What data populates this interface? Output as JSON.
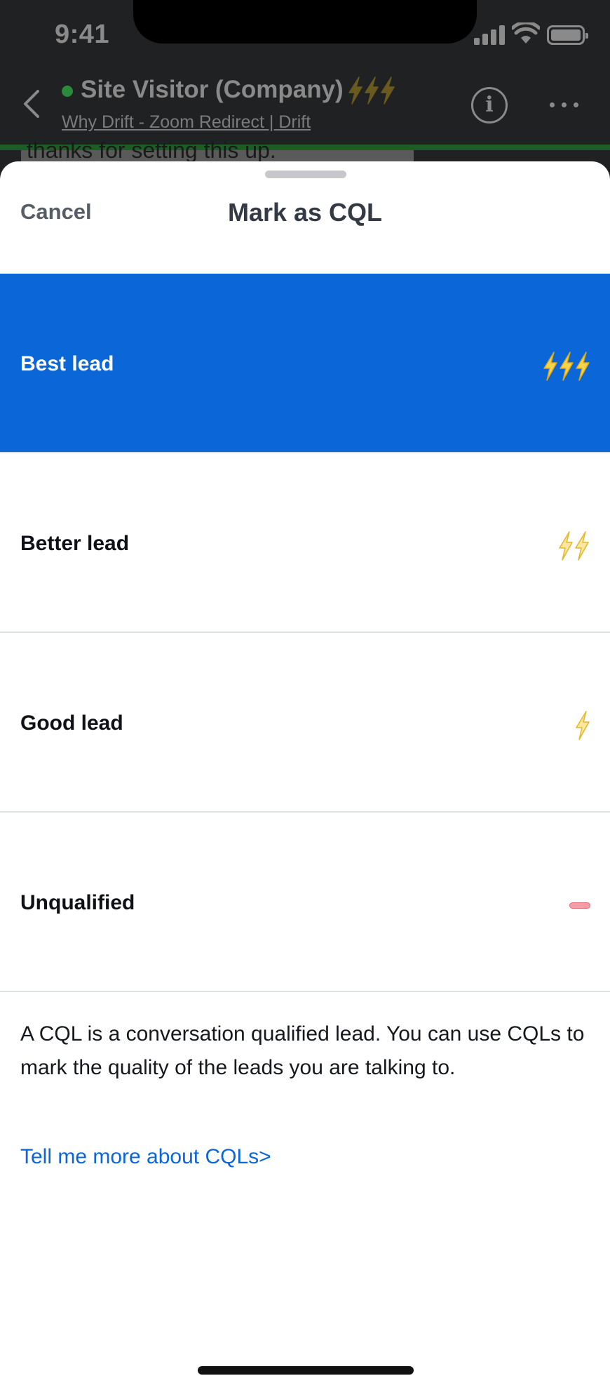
{
  "status": {
    "time": "9:41"
  },
  "background_chat": {
    "visitor_name": "Site Visitor (Company)",
    "page_link": "Why Drift - Zoom Redirect | Drift",
    "peek_message": "thanks for setting this up."
  },
  "sheet": {
    "cancel_label": "Cancel",
    "title": "Mark as CQL",
    "options": [
      {
        "label": "Best lead",
        "icon": "bolt-icon",
        "bolts": 3,
        "selected": true
      },
      {
        "label": "Better lead",
        "icon": "bolt-icon",
        "bolts": 2,
        "selected": false
      },
      {
        "label": "Good lead",
        "icon": "bolt-icon",
        "bolts": 1,
        "selected": false
      },
      {
        "label": "Unqualified",
        "icon": "dash-icon",
        "bolts": 0,
        "selected": false
      }
    ],
    "description": "A CQL is a conversation qualified lead. You can use CQLs to mark the quality of the leads you are talking to.",
    "more_link": "Tell me more about CQLs>"
  },
  "colors": {
    "accent": "#0b66d8",
    "bolt_yellow": "#f6d44a",
    "bolt_stroke": "#d9a91b",
    "unqualified_red": "#e06a73"
  }
}
